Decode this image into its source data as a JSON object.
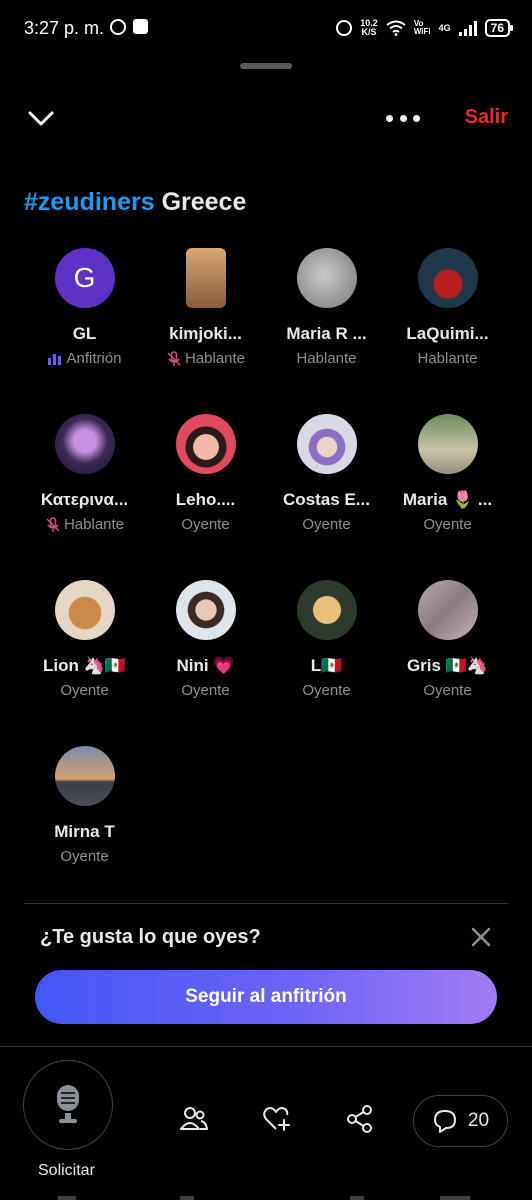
{
  "status_bar": {
    "time": "3:27 p. m.",
    "speed_value": "10.2",
    "speed_unit": "K/S",
    "vowifi_top": "Vo",
    "vowifi_bottom": "WiFi",
    "network": "4G",
    "battery": "76"
  },
  "header": {
    "exit_label": "Salir"
  },
  "space": {
    "hashtag": "#zeudiners",
    "title_rest": "Greece"
  },
  "participants": [
    {
      "name": "GL",
      "role": "Anfitrión",
      "role_icon": "speaking-bars-icon"
    },
    {
      "name": "kimjoki...",
      "role": "Hablante",
      "role_icon": "mic-muted-icon"
    },
    {
      "name": "Maria R ...",
      "role": "Hablante",
      "role_icon": ""
    },
    {
      "name": "LaQuimi...",
      "role": "Hablante",
      "role_icon": ""
    },
    {
      "name": "Κατερινα...",
      "role": "Hablante",
      "role_icon": "mic-muted-icon"
    },
    {
      "name": "Leho....",
      "role": "Oyente",
      "role_icon": ""
    },
    {
      "name": "Costas E...",
      "role": "Oyente",
      "role_icon": ""
    },
    {
      "name": "Maria 🌷 ...",
      "role": "Oyente",
      "role_icon": ""
    },
    {
      "name": "Lion 🦄🇲🇽",
      "role": "Oyente",
      "role_icon": ""
    },
    {
      "name": "Nini 💗",
      "role": "Oyente",
      "role_icon": ""
    },
    {
      "name": "L🇲🇽",
      "role": "Oyente",
      "role_icon": ""
    },
    {
      "name": "Gris 🇲🇽🦄",
      "role": "Oyente",
      "role_icon": ""
    },
    {
      "name": "Mirna T",
      "role": "Oyente",
      "role_icon": ""
    }
  ],
  "avatar_initial": "G",
  "colors": {
    "accent_blue": "#1d9bf0",
    "exit_red": "#f4212e",
    "host_purple": "#5d33c6",
    "speaking_icon": "#7856ff"
  },
  "follow_prompt": {
    "question": "¿Te gusta lo que oyes?",
    "button_label": "Seguir al anfitrión"
  },
  "bottom_bar": {
    "request_label": "Solicitar",
    "comments_count": "20",
    "icons": [
      "mic-icon",
      "people-icon",
      "heart-plus-icon",
      "share-icon",
      "comment-icon"
    ]
  }
}
